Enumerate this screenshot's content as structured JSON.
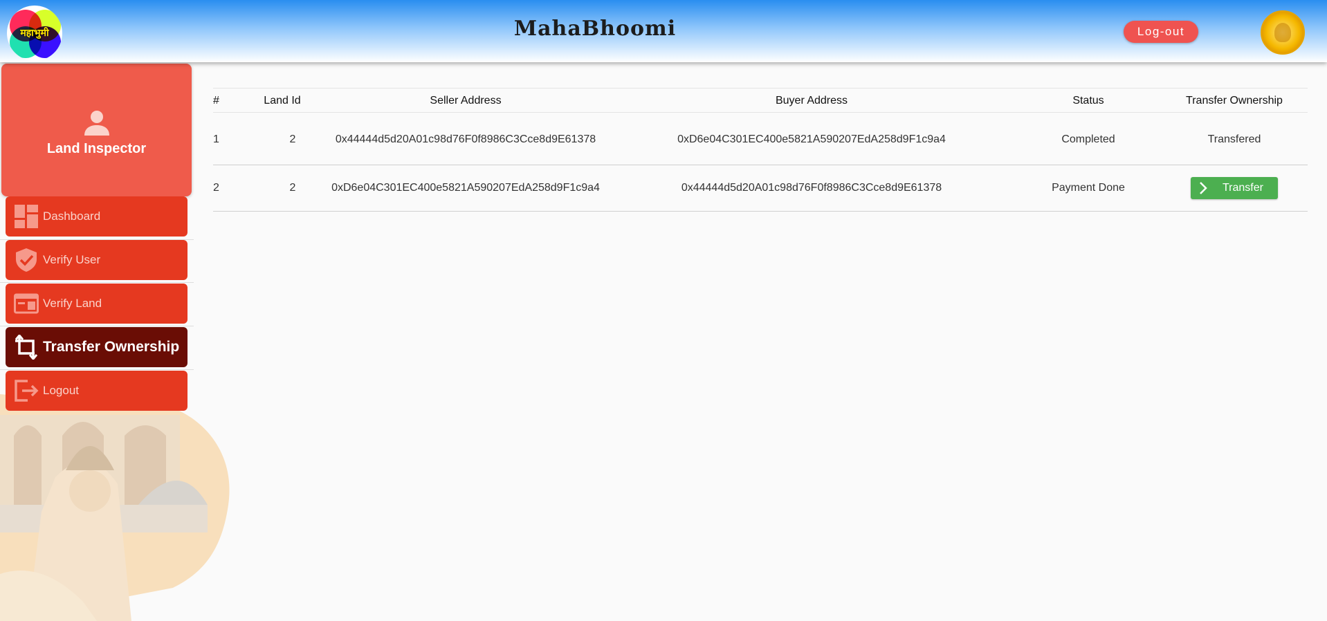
{
  "header": {
    "logo_text": "महाभुमी",
    "title": "MahaBhoomi",
    "logout_label": "Log-out"
  },
  "sidebar": {
    "profile": {
      "name": "Land Inspector",
      "icon": "user-icon"
    },
    "items": [
      {
        "label": "Dashboard",
        "icon": "dashboard-icon",
        "active": false
      },
      {
        "label": "Verify User",
        "icon": "shield-check-icon",
        "active": false
      },
      {
        "label": "Verify Land",
        "icon": "land-icon",
        "active": false
      },
      {
        "label": "Transfer Ownership",
        "icon": "transfer-icon",
        "active": true
      },
      {
        "label": "Logout",
        "icon": "logout-icon",
        "active": false
      }
    ]
  },
  "table": {
    "headers": [
      "#",
      "Land Id",
      "Seller Address",
      "Buyer Address",
      "Status",
      "Transfer Ownership"
    ],
    "rows": [
      {
        "index": "1",
        "land_id": "2",
        "seller": "0x44444d5d20A01c98d76F0f8986C3Cce8d9E61378",
        "buyer": "0xD6e04C301EC400e5821A590207EdA258d9F1c9a4",
        "status": "Completed",
        "action": "Transfered"
      },
      {
        "index": "2",
        "land_id": "2",
        "seller": "0xD6e04C301EC400e5821A590207EdA258d9F1c9a4",
        "buyer": "0x44444d5d20A01c98d76F0f8986C3Cce8d9E61378",
        "status": "Payment Done",
        "action_button": "Transfer"
      }
    ]
  },
  "colors": {
    "nav_bg": "#e53920",
    "nav_active_bg": "#6a0d05",
    "profile_bg": "#ef5b4b",
    "logout_pill": "#ef5350",
    "transfer_button": "#4caf50"
  }
}
